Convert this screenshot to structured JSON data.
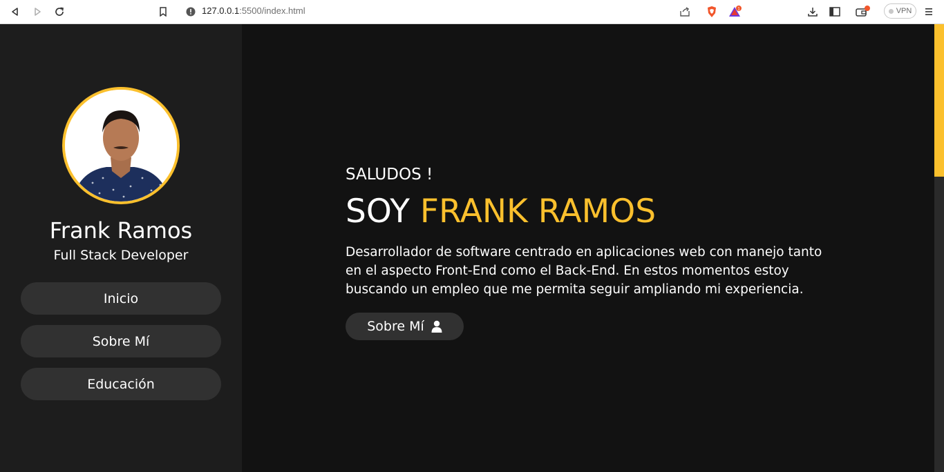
{
  "browser": {
    "url_host": "127.0.0.1",
    "url_path": ":5500/index.html",
    "vpn_label": "VPN",
    "brave_badge": "1"
  },
  "sidebar": {
    "name": "Frank Ramos",
    "role": "Full Stack Developer",
    "menu": [
      {
        "label": "Inicio"
      },
      {
        "label": "Sobre Mí"
      },
      {
        "label": "Educación"
      }
    ]
  },
  "hero": {
    "greeting": "SALUDOS !",
    "headline_prefix": "SOY",
    "headline_name": "FRANK RAMOS",
    "bio": "Desarrollador de software centrado en aplicaciones web con manejo tanto en el aspecto Front-End como el Back-End. En estos momentos estoy buscando un empleo que me permita seguir ampliando mi experiencia.",
    "cta_label": "Sobre Mí"
  },
  "colors": {
    "accent": "#fbc02d",
    "sidebar_bg": "#1d1d1d",
    "main_bg": "#121212",
    "button_bg": "#313131"
  }
}
